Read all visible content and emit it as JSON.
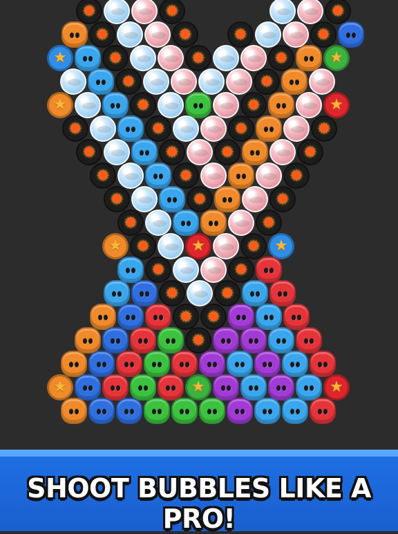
{
  "banner": {
    "text": "SHOOT BUBBLES LIKE A PRO!"
  },
  "colors": {
    "board_background": "#2c2c2c",
    "banner_blue": "#1e6fe3",
    "orange": "#f08a2a",
    "blue": "#2f6fe0",
    "cyan": "#3aa6ee",
    "red": "#e5343a",
    "green": "#3bc23f",
    "purple": "#a23bd6"
  },
  "bubble_rows": [
    [
      "bomb",
      "glass-blue",
      "glass-pink",
      "bomb",
      "",
      "",
      "",
      "glass-blue",
      "glass-pink",
      "bomb"
    ],
    [
      "orange",
      "bomb",
      "glass-blue",
      "glass-pink",
      "bomb",
      "",
      "bomb",
      "glass-blue",
      "glass-pink",
      "bomb",
      "blue"
    ],
    [
      "star-blue",
      "cyan",
      "bomb",
      "glass-blue",
      "glass-pink",
      "bomb",
      "glass-blue",
      "glass-pink",
      "bomb",
      "orange",
      "star-green"
    ],
    [
      "glass-blue",
      "cyan",
      "bomb",
      "glass-blue",
      "glass-pink",
      "glass-blue",
      "glass-pink",
      "bomb",
      "orange",
      "glass-pink"
    ],
    [
      "star-orange",
      "glass-blue",
      "cyan",
      "bomb",
      "glass-blue",
      "green",
      "glass-pink",
      "bomb",
      "orange",
      "glass-pink",
      "star-red"
    ],
    [
      "bomb",
      "glass-blue",
      "cyan",
      "bomb",
      "glass-blue",
      "glass-pink",
      "bomb",
      "orange",
      "glass-pink",
      "bomb"
    ],
    [
      "bomb",
      "glass-blue",
      "cyan",
      "bomb",
      "glass-pink",
      "bomb",
      "orange",
      "glass-pink",
      "bomb"
    ],
    [
      "bomb",
      "glass-blue",
      "cyan",
      "bomb",
      "glass-pink",
      "orange",
      "glass-pink",
      "bomb"
    ],
    [
      "bomb",
      "glass-blue",
      "cyan",
      "bomb",
      "orange",
      "glass-pink",
      "bomb"
    ],
    [
      "bomb",
      "glass-blue",
      "cyan",
      "orange",
      "glass-pink",
      "bomb"
    ],
    [
      "star-orange",
      "bomb",
      "glass-blue",
      "star-red",
      "glass-pink",
      "bomb",
      "star-blue"
    ],
    [
      "cyan",
      "bomb",
      "glass-blue",
      "glass-pink",
      "bomb",
      "red"
    ],
    [
      "cyan",
      "blue",
      "bomb",
      "glass-blue",
      "bomb",
      "cyan",
      "red"
    ],
    [
      "orange",
      "blue",
      "red",
      "bomb",
      "bomb",
      "purple",
      "cyan",
      "red"
    ],
    [
      "orange",
      "blue",
      "red",
      "green",
      "bomb",
      "purple",
      "purple",
      "cyan",
      "red"
    ],
    [
      "orange",
      "blue",
      "red",
      "green",
      "red",
      "purple",
      "cyan",
      "purple",
      "cyan",
      "red"
    ],
    [
      "star-orange",
      "blue",
      "red",
      "green",
      "red",
      "star-green",
      "purple",
      "cyan",
      "purple",
      "cyan",
      "star-red"
    ],
    [
      "orange",
      "blue",
      "blue",
      "green",
      "green",
      "green",
      "purple",
      "cyan",
      "cyan",
      "red"
    ]
  ]
}
